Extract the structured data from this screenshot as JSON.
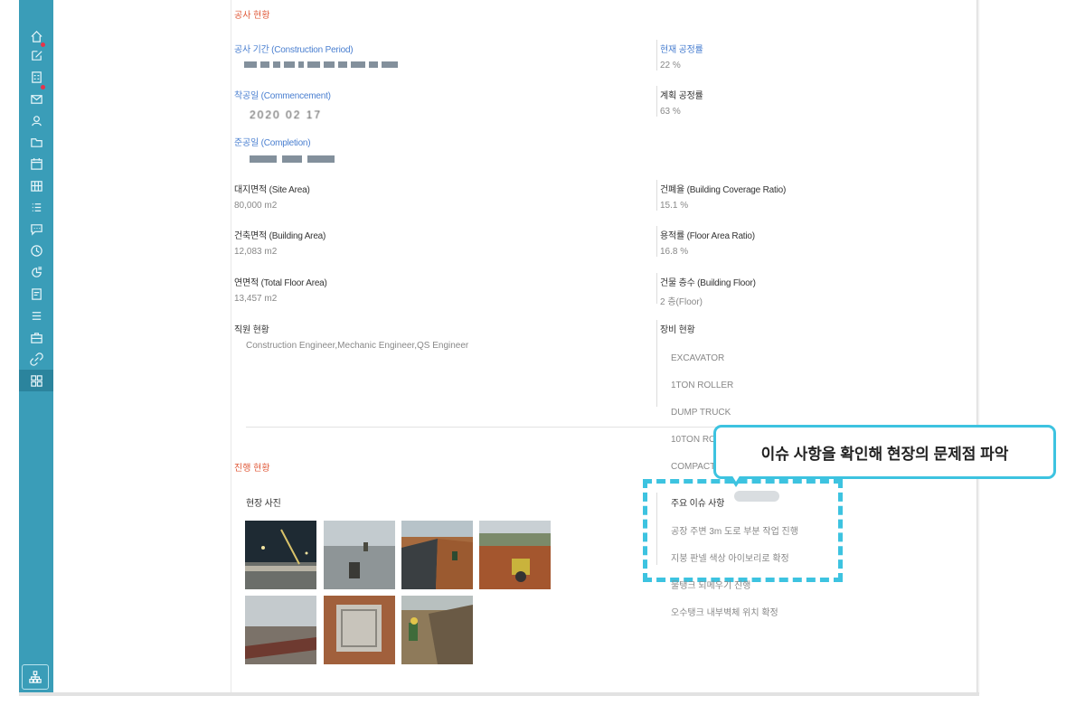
{
  "sidebar": {
    "icons": [
      "home-icon",
      "edit-icon",
      "list-card-icon",
      "mail-icon",
      "user-icon",
      "folder-icon",
      "calendar-icon",
      "grid-calendar-icon",
      "list-icon",
      "chat-icon",
      "clock-icon",
      "chart-icon",
      "document-icon",
      "dashboard-icon",
      "stack-icon",
      "briefcase-icon",
      "link-icon"
    ],
    "active": "dashboard-icon",
    "badges": [
      "edit-icon",
      "mail-icon"
    ],
    "bottom_icon": "org-chart-icon"
  },
  "construction": {
    "title": "공사 현황",
    "period_label": "공사 기간 (Construction Period)",
    "commencement_label": "착공일 (Commencement)",
    "commencement_value": "2020 02 17",
    "completion_label": "준공일 (Completion)",
    "current_progress_label": "현재 공정률",
    "current_progress_value": "22 %",
    "planned_progress_label": "계획 공정률",
    "planned_progress_value": "63 %",
    "site_area_label": "대지면적 (Site Area)",
    "site_area_value": "80,000 m2",
    "coverage_label": "건폐율 (Building Coverage Ratio)",
    "coverage_value": "15.1 %",
    "building_area_label": "건축면적 (Building Area)",
    "building_area_value": "12,083 m2",
    "far_label": "용적률 (Floor Area Ratio)",
    "far_value": "16.8 %",
    "total_floor_label": "연면적 (Total Floor Area)",
    "total_floor_value": "13,457 m2",
    "floors_label": "건물 층수 (Building Floor)",
    "floors_value": "2 층(Floor)",
    "staff_label": "직원 현황",
    "staff_value": "Construction Engineer,Mechanic Engineer,QS Engineer",
    "equipment_label": "장비 현황",
    "equipment": [
      "EXCAVATOR",
      "1TON ROLLER",
      "DUMP TRUCK",
      "10TON ROLLER",
      "COMPACTOR"
    ]
  },
  "progress": {
    "title": "진행 현황",
    "photos_label": "현장 사진",
    "issues_label": "주요 이슈 사항",
    "issues": [
      "공장 주변 3m 도로 부분 작업 진행",
      "지붕 판넬 색상 아이보리로 확정",
      "물탱크 되메우기 진행",
      "오수탱크 내부벽체 위치 확정"
    ]
  },
  "callout": {
    "text": "이슈 사항을 확인해 현장의 문제점 파악"
  },
  "colors": {
    "sidebar": "#3a9db8",
    "accent_title": "#e05a3a",
    "label_blue": "#4a7fd0",
    "callout_border": "#3dc3e0"
  }
}
